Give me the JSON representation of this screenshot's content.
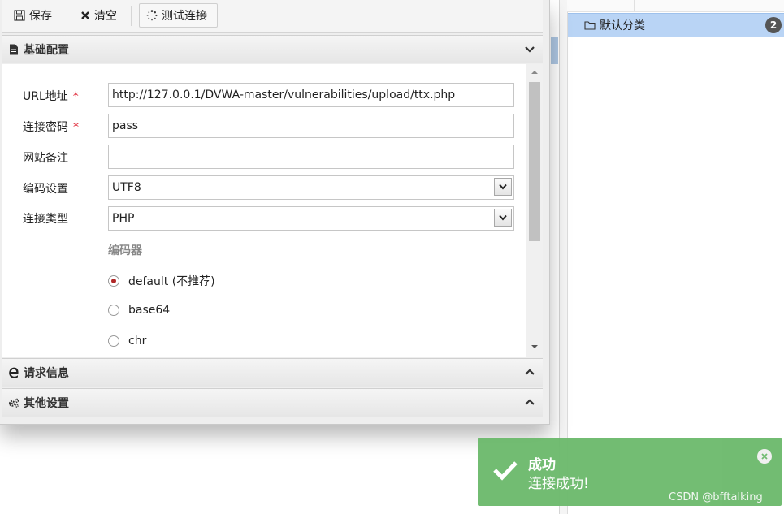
{
  "toolbar": {
    "save_label": "保存",
    "clear_label": "清空",
    "test_label": "测试连接"
  },
  "sections": {
    "basic": {
      "title": "基础配置",
      "expanded": true
    },
    "request": {
      "title": "请求信息",
      "expanded": false
    },
    "other": {
      "title": "其他设置",
      "expanded": false
    }
  },
  "form": {
    "url": {
      "label": "URL地址",
      "required": "*",
      "value": "http://127.0.0.1/DVWA-master/vulnerabilities/upload/ttx.php"
    },
    "password": {
      "label": "连接密码",
      "required": "*",
      "value": "pass"
    },
    "note": {
      "label": "网站备注",
      "value": ""
    },
    "encoding": {
      "label": "编码设置",
      "value": "UTF8"
    },
    "type": {
      "label": "连接类型",
      "value": "PHP"
    },
    "encoder": {
      "title": "编码器",
      "options": [
        "default (不推荐)",
        "base64",
        "chr"
      ],
      "selected": "default (不推荐)"
    }
  },
  "sidebar": {
    "category_label": "默认分类",
    "category_count": "2"
  },
  "toast": {
    "title": "成功",
    "message": "连接成功!"
  },
  "watermark": "CSDN @bfftalking",
  "colors": {
    "toast_bg": "#6dba6d",
    "selected_row": "#b9d4f5",
    "required": "#dd1122"
  }
}
